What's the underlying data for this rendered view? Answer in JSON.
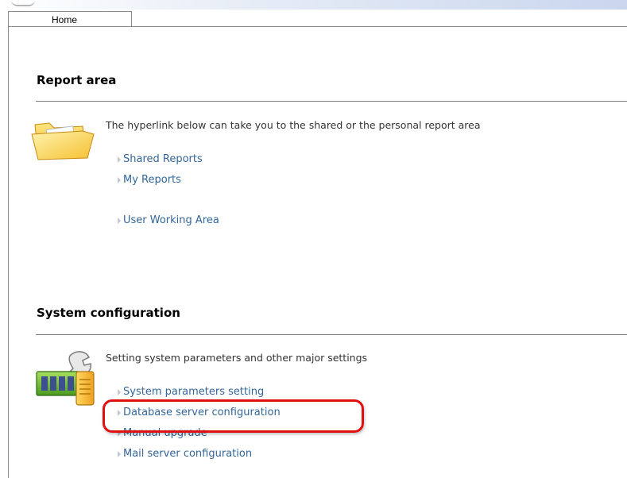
{
  "tab": {
    "label": "Home"
  },
  "report": {
    "title": "Report area",
    "description": "The hyperlink below can take you to the shared or the personal report area",
    "links": [
      "Shared Reports",
      "My Reports",
      "User Working Area"
    ]
  },
  "system": {
    "title": "System configuration",
    "description": "Setting system parameters and other major settings",
    "links": [
      "System parameters setting",
      "Database server configuration",
      "Manual upgrade",
      "Mail server configuration"
    ]
  },
  "colors": {
    "link": "#336699",
    "highlight": "#e01010"
  },
  "icons": {
    "report": "folder-icon",
    "system": "settings-hardware-icon"
  }
}
